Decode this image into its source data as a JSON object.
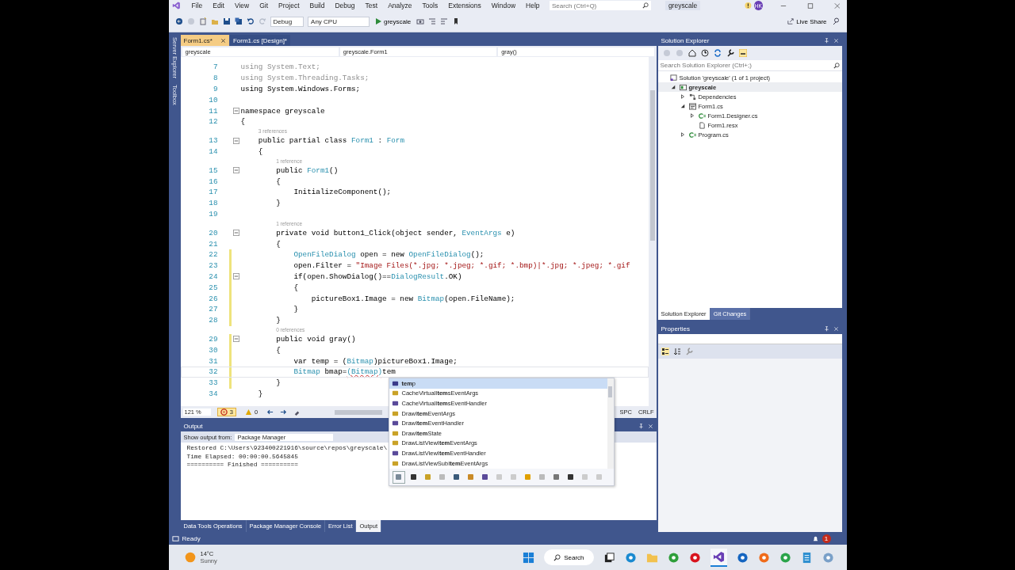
{
  "title_bar": {
    "menu": [
      "File",
      "Edit",
      "View",
      "Git",
      "Project",
      "Build",
      "Debug",
      "Test",
      "Analyze",
      "Tools",
      "Extensions",
      "Window",
      "Help"
    ],
    "search_placeholder": "Search (Ctrl+Q)",
    "solution": "greyscale",
    "avatar": "HK"
  },
  "toolbar": {
    "configuration": "Debug",
    "platform": "Any CPU",
    "start": "greyscale",
    "live_share": "Live Share"
  },
  "side_tabs": [
    "Server Explorer",
    "Toolbox"
  ],
  "editor": {
    "tabs": [
      {
        "label": "Form1.cs*",
        "selected": true
      },
      {
        "label": "Form1.cs [Design]*",
        "selected": false
      }
    ],
    "nav": [
      "greyscale",
      "greyscale.Form1",
      "gray()"
    ],
    "lines": [
      {
        "kind": "code",
        "n": "7",
        "changed": false,
        "fold": false,
        "current": false,
        "seg": [
          {
            "kind": "dim",
            "text": "using System.Text;"
          }
        ]
      },
      {
        "kind": "code",
        "n": "8",
        "changed": false,
        "fold": false,
        "current": false,
        "seg": [
          {
            "kind": "dim",
            "text": "using System.Threading.Tasks;"
          }
        ]
      },
      {
        "kind": "code",
        "n": "9",
        "changed": false,
        "fold": false,
        "current": false,
        "seg": [
          {
            "kind": "plain",
            "text": "using System.Windows.Forms;"
          }
        ]
      },
      {
        "kind": "code",
        "n": "10",
        "changed": false,
        "fold": false,
        "current": false
      },
      {
        "kind": "code",
        "n": "11",
        "changed": false,
        "fold": true,
        "current": false,
        "seg": [
          {
            "kind": "plain",
            "text": "namespace greyscale"
          }
        ]
      },
      {
        "kind": "code",
        "n": "12",
        "changed": false,
        "fold": false,
        "current": false,
        "seg": [
          {
            "kind": "plain",
            "text": "{"
          }
        ]
      },
      {
        "kind": "lens",
        "text": "3 references"
      },
      {
        "kind": "code",
        "n": "13",
        "changed": false,
        "fold": true,
        "current": false,
        "seg": [
          {
            "kind": "plain",
            "text": "    public partial class "
          },
          {
            "kind": "type",
            "text": "Form1"
          },
          {
            "kind": "plain",
            "text": " : "
          },
          {
            "kind": "type",
            "text": "Form"
          }
        ]
      },
      {
        "kind": "code",
        "n": "14",
        "changed": false,
        "fold": false,
        "current": false,
        "seg": [
          {
            "kind": "plain",
            "text": "    {"
          }
        ]
      },
      {
        "kind": "lens",
        "text": "1 reference"
      },
      {
        "kind": "code",
        "n": "15",
        "changed": false,
        "fold": true,
        "current": false,
        "seg": [
          {
            "kind": "plain",
            "text": "        public "
          },
          {
            "kind": "type",
            "text": "Form1"
          },
          {
            "kind": "plain",
            "text": "()"
          }
        ]
      },
      {
        "kind": "code",
        "n": "16",
        "changed": false,
        "fold": false,
        "current": false,
        "seg": [
          {
            "kind": "plain",
            "text": "        {"
          }
        ]
      },
      {
        "kind": "code",
        "n": "17",
        "changed": false,
        "fold": false,
        "current": false,
        "seg": [
          {
            "kind": "plain",
            "text": "            InitializeComponent();"
          }
        ]
      },
      {
        "kind": "code",
        "n": "18",
        "changed": false,
        "fold": false,
        "current": false,
        "seg": [
          {
            "kind": "plain",
            "text": "        }"
          }
        ]
      },
      {
        "kind": "code",
        "n": "19",
        "changed": false,
        "fold": false,
        "current": false
      },
      {
        "kind": "lens",
        "text": "1 reference"
      },
      {
        "kind": "code",
        "n": "20",
        "changed": false,
        "fold": true,
        "current": false,
        "seg": [
          {
            "kind": "plain",
            "text": "        private void button1_Click(object sender, "
          },
          {
            "kind": "type",
            "text": "EventArgs"
          },
          {
            "kind": "plain",
            "text": " e)"
          }
        ]
      },
      {
        "kind": "code",
        "n": "21",
        "changed": false,
        "fold": false,
        "current": false,
        "seg": [
          {
            "kind": "plain",
            "text": "        {"
          }
        ]
      },
      {
        "kind": "code",
        "n": "22",
        "changed": true,
        "fold": false,
        "current": false,
        "seg": [
          {
            "kind": "type",
            "text": "            OpenFileDialog"
          },
          {
            "kind": "plain",
            "text": " open = new "
          },
          {
            "kind": "type",
            "text": "OpenFileDialog"
          },
          {
            "kind": "plain",
            "text": "();"
          }
        ]
      },
      {
        "kind": "code",
        "n": "23",
        "changed": true,
        "fold": false,
        "current": false,
        "seg": [
          {
            "kind": "plain",
            "text": "            open.Filter = "
          },
          {
            "kind": "string",
            "text": "\"Image Files(*.jpg; *.jpeg; *.gif; *.bmp)|*.jpg; *.jpeg; *.gif"
          }
        ]
      },
      {
        "kind": "code",
        "n": "24",
        "changed": true,
        "fold": true,
        "current": false,
        "seg": [
          {
            "kind": "plain",
            "text": "            if(open.ShowDialog()=="
          },
          {
            "kind": "type",
            "text": "DialogResult"
          },
          {
            "kind": "plain",
            "text": ".OK)"
          }
        ]
      },
      {
        "kind": "code",
        "n": "25",
        "changed": true,
        "fold": false,
        "current": false,
        "seg": [
          {
            "kind": "plain",
            "text": "            {"
          }
        ]
      },
      {
        "kind": "code",
        "n": "26",
        "changed": true,
        "fold": false,
        "current": false,
        "seg": [
          {
            "kind": "plain",
            "text": "                pictureBox1.Image = new "
          },
          {
            "kind": "type",
            "text": "Bitmap"
          },
          {
            "kind": "plain",
            "text": "(open.FileName);"
          }
        ]
      },
      {
        "kind": "code",
        "n": "27",
        "changed": true,
        "fold": false,
        "current": false,
        "seg": [
          {
            "kind": "plain",
            "text": "            }"
          }
        ]
      },
      {
        "kind": "code",
        "n": "28",
        "changed": true,
        "fold": false,
        "current": false,
        "seg": [
          {
            "kind": "plain",
            "text": "        }"
          }
        ]
      },
      {
        "kind": "lens",
        "text": "0 references"
      },
      {
        "kind": "code",
        "n": "29",
        "changed": true,
        "fold": true,
        "current": false,
        "seg": [
          {
            "kind": "plain",
            "text": "        public void gray()"
          }
        ]
      },
      {
        "kind": "code",
        "n": "30",
        "changed": true,
        "fold": false,
        "current": false,
        "seg": [
          {
            "kind": "plain",
            "text": "        {"
          }
        ]
      },
      {
        "kind": "code",
        "n": "31",
        "changed": true,
        "fold": false,
        "current": false,
        "seg": [
          {
            "kind": "plain",
            "text": "            var temp = ("
          },
          {
            "kind": "type",
            "text": "Bitmap"
          },
          {
            "kind": "plain",
            "text": ")pictureBox1.Image;"
          }
        ]
      },
      {
        "kind": "code",
        "n": "32",
        "changed": true,
        "fold": false,
        "current": true,
        "seg": [
          {
            "kind": "type",
            "text": "            Bitmap"
          },
          {
            "kind": "plain",
            "text": " bmap="
          },
          {
            "kind": "error",
            "text": "(Bitmap)"
          },
          {
            "kind": "plain",
            "text": "tem"
          }
        ]
      },
      {
        "kind": "code",
        "n": "33",
        "changed": true,
        "fold": false,
        "current": false,
        "seg": [
          {
            "kind": "plain",
            "text": "        }"
          }
        ]
      },
      {
        "kind": "code",
        "n": "34",
        "changed": false,
        "fold": false,
        "current": false,
        "seg": [
          {
            "kind": "plain",
            "text": "    }"
          }
        ]
      }
    ],
    "status": {
      "zoom": "121 %",
      "errors": "3",
      "warnings": "0",
      "whitespace": "SPC",
      "line_ending": "CRLF"
    }
  },
  "completion": {
    "items": [
      {
        "label": "**tem**p",
        "kind": "local",
        "selected": true
      },
      {
        "label": "CacheVirtualI**tem**sEventArgs",
        "kind": "class",
        "selected": false
      },
      {
        "label": "CacheVirtualI**tem**sEventHandler",
        "kind": "delegate",
        "selected": false
      },
      {
        "label": "DrawI**tem**EventArgs",
        "kind": "class",
        "selected": false
      },
      {
        "label": "DrawI**tem**EventHandler",
        "kind": "delegate",
        "selected": false
      },
      {
        "label": "DrawI**tem**State",
        "kind": "enum",
        "selected": false
      },
      {
        "label": "DrawListViewI**tem**EventArgs",
        "kind": "class",
        "selected": false
      },
      {
        "label": "DrawListViewI**tem**EventHandler",
        "kind": "delegate",
        "selected": false
      },
      {
        "label": "DrawListViewSubI**tem**EventArgs",
        "kind": "class",
        "selected": false
      }
    ]
  },
  "output": {
    "title": "Output",
    "source_label": "Show output from:",
    "source": "Package Manager",
    "lines": [
      "Restored C:\\Users\\923400221916\\source\\repos\\greyscale\\",
      "Time Elapsed: 00:00:00.5645845",
      "========== Finished =========="
    ],
    "tabs": [
      {
        "label": "Data Tools Operations",
        "selected": false
      },
      {
        "label": "Package Manager Console",
        "selected": false
      },
      {
        "label": "Error List",
        "selected": false
      },
      {
        "label": "Output",
        "selected": true
      }
    ]
  },
  "solution_explorer": {
    "title": "Solution Explorer",
    "search_placeholder": "Search Solution Explorer (Ctrl+;)",
    "tree": [
      {
        "label": "Solution 'greyscale' (1 of 1 project)",
        "kind": "solution",
        "selected": false,
        "children": [
          {
            "label": "greyscale",
            "kind": "project",
            "selected": true,
            "expanded": true,
            "children": [
              {
                "label": "Dependencies",
                "kind": "dependencies",
                "selected": false,
                "expanded": false
              },
              {
                "label": "Form1.cs",
                "kind": "form",
                "selected": false,
                "expanded": true,
                "children": [
                  {
                    "label": "Form1.Designer.cs",
                    "kind": "csharp",
                    "selected": false,
                    "expanded": false
                  },
                  {
                    "label": "Form1.resx",
                    "kind": "resx",
                    "selected": false
                  }
                ]
              },
              {
                "label": "Program.cs",
                "kind": "csharp",
                "selected": false,
                "expanded": false
              }
            ]
          }
        ]
      }
    ],
    "tabs": [
      {
        "label": "Solution Explorer",
        "selected": true
      },
      {
        "label": "Git Changes",
        "selected": false
      }
    ]
  },
  "properties": {
    "title": "Properties"
  },
  "status_bar": {
    "text": "Ready",
    "notifications": "1"
  },
  "taskbar": {
    "temperature": "14°C",
    "condition": "Sunny",
    "search": "Search",
    "apps": [
      {
        "kind": "start"
      },
      {
        "kind": "search"
      },
      {
        "kind": "taskview"
      },
      {
        "kind": "edge"
      },
      {
        "kind": "folder"
      },
      {
        "kind": "torrent"
      },
      {
        "kind": "opera"
      },
      {
        "kind": "vs",
        "selected": true
      },
      {
        "kind": "outlook"
      },
      {
        "kind": "firefox"
      },
      {
        "kind": "chrome"
      },
      {
        "kind": "notepad"
      },
      {
        "kind": "generic"
      }
    ]
  }
}
